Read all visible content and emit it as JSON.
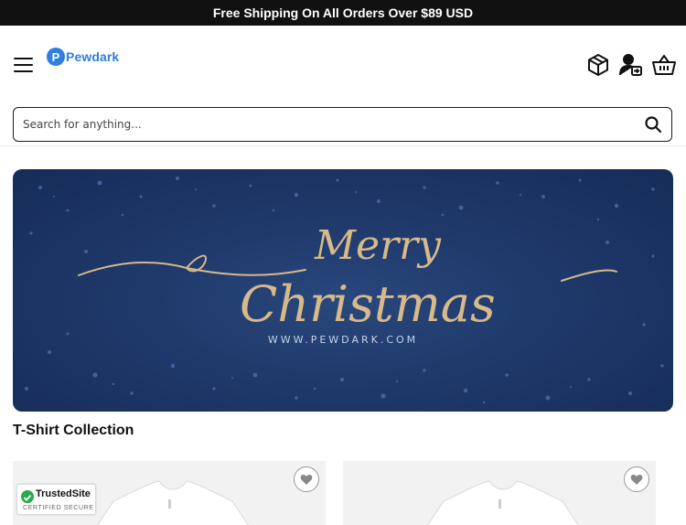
{
  "promo": {
    "text": "Free Shipping On All Orders Over $89 USD"
  },
  "header": {
    "logo_mark": "P",
    "logo_text": "Pewdark",
    "icons": [
      "menu-icon",
      "package-icon",
      "user-login-icon",
      "cart-basket-icon"
    ]
  },
  "search": {
    "placeholder": "Search for anything..."
  },
  "banner": {
    "line1": "Merry",
    "line2": "Christmas",
    "url": "WWW.PEWDARK.COM"
  },
  "collection": {
    "title": "T-Shirt Collection"
  },
  "trust_badge": {
    "name": "TrustedSite",
    "sub": "CERTIFIED SECURE"
  },
  "colors": {
    "brand": "#2f7fe0",
    "promo_bg": "#111111",
    "banner_bg": "#203a6c",
    "gold": "#d7b98a"
  }
}
